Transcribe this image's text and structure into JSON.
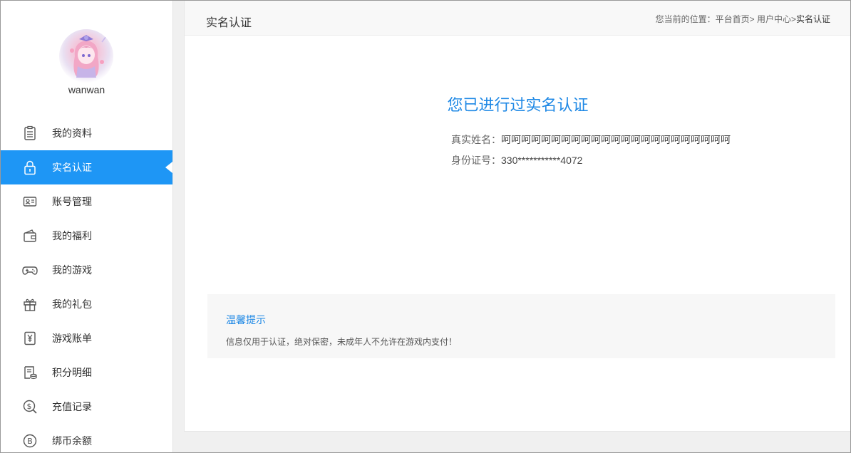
{
  "user": {
    "name": "wanwan"
  },
  "sidebar": {
    "items": [
      {
        "label": "我的资料",
        "icon": "profile-doc-icon"
      },
      {
        "label": "实名认证",
        "icon": "lock-icon",
        "active": true
      },
      {
        "label": "账号管理",
        "icon": "id-card-icon"
      },
      {
        "label": "我的福利",
        "icon": "wallet-icon"
      },
      {
        "label": "我的游戏",
        "icon": "gamepad-icon"
      },
      {
        "label": "我的礼包",
        "icon": "gift-icon"
      },
      {
        "label": "游戏账单",
        "icon": "yen-bill-icon"
      },
      {
        "label": "积分明细",
        "icon": "points-doc-icon"
      },
      {
        "label": "充值记录",
        "icon": "dollar-coin-icon"
      },
      {
        "label": "绑币余额",
        "icon": "b-coin-icon"
      }
    ]
  },
  "header": {
    "title": "实名认证",
    "breadcrumb_prefix": "您当前的位置：",
    "crumb_home": "平台首页",
    "crumb_sep1": ">",
    "crumb_user": "用户中心",
    "crumb_sep2": ">",
    "crumb_current": "实名认证"
  },
  "content": {
    "status": "您已进行过实名认证",
    "name_label": "真实姓名：",
    "name_value": "呵呵呵呵呵呵呵呵呵呵呵呵呵呵呵呵呵呵呵呵呵呵呵",
    "id_label": "身份证号：",
    "id_value": "330***********4072"
  },
  "tips": {
    "title": "温馨提示",
    "text": "信息仅用于认证，绝对保密，未成年人不允许在游戏内支付！"
  },
  "colors": {
    "accent": "#1e96f5",
    "link": "#1e88e5"
  }
}
